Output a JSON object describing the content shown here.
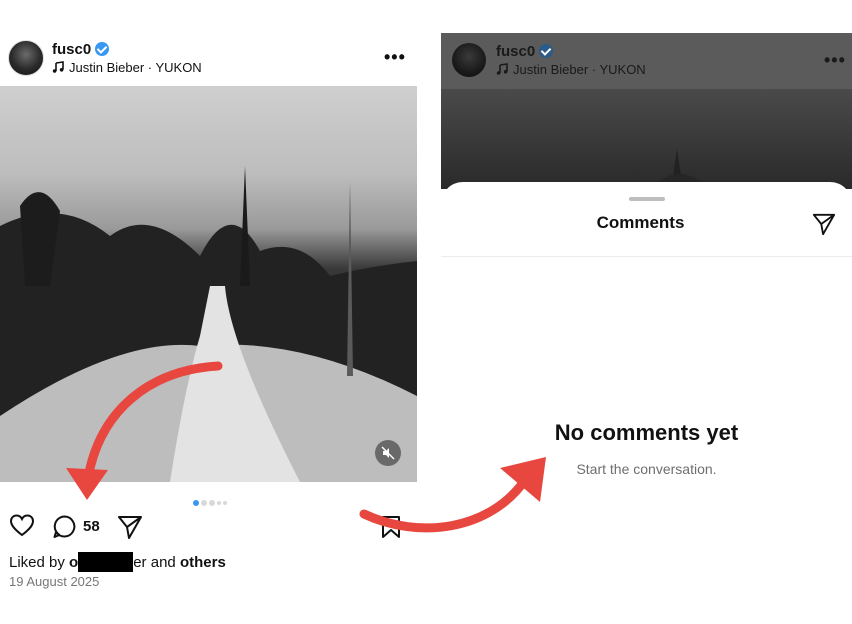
{
  "post": {
    "username": "fusc0",
    "music": "Justin Bieber · YUKON",
    "more_label": "•••",
    "comment_count": "58",
    "liked_prefix": "Liked by ",
    "liked_partial_start": "o",
    "liked_partial_end": "er",
    "liked_and": " and ",
    "liked_others": "others",
    "date": "19 August 2025",
    "carousel": {
      "count": 4,
      "active_index": 0
    }
  },
  "comments_sheet": {
    "username": "fusc0",
    "music": "Justin Bieber · YUKON",
    "more_label": "•••",
    "title": "Comments",
    "empty_title": "No comments yet",
    "empty_subtitle": "Start the conversation."
  },
  "colors": {
    "accent_blue": "#3897f0",
    "annotation_red": "#e8473f",
    "overlay_gray": "#5b5b5b"
  },
  "icons": [
    "verified-badge-icon",
    "music-note-icon",
    "more-icon",
    "mute-icon",
    "heart-icon",
    "comment-icon",
    "share-icon",
    "bookmark-icon",
    "send-icon"
  ]
}
